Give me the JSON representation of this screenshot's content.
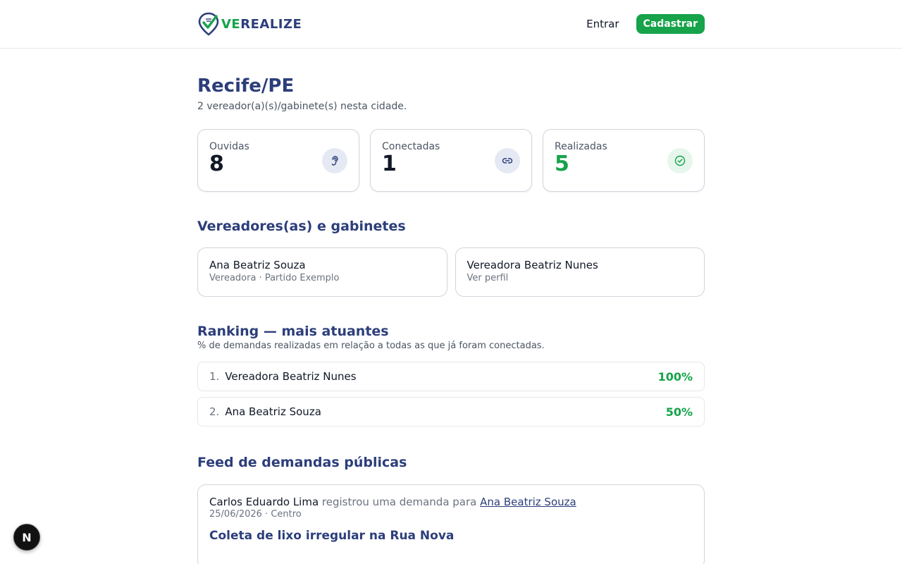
{
  "header": {
    "logo_prefix": "VE",
    "logo_rest": "REALIZE",
    "login_label": "Entrar",
    "signup_label": "Cadastrar"
  },
  "page": {
    "title": "Recife/PE",
    "subtitle": "2 vereador(a)(s)/gabinete(s) nesta cidade."
  },
  "stats": [
    {
      "label": "Ouvidas",
      "value": "8",
      "icon": "ear-icon"
    },
    {
      "label": "Conectadas",
      "value": "1",
      "icon": "link-icon"
    },
    {
      "label": "Realizadas",
      "value": "5",
      "icon": "check-circle-icon"
    }
  ],
  "council": {
    "title": "Vereadores(as) e gabinetes",
    "items": [
      {
        "name": "Ana Beatriz Souza",
        "meta": "Vereadora · Partido Exemplo"
      },
      {
        "name": "Vereadora Beatriz Nunes",
        "meta": "Ver perfil"
      }
    ]
  },
  "ranking": {
    "title": "Ranking — mais atuantes",
    "subtitle": "% de demandas realizadas em relação a todas as que já foram conectadas.",
    "items": [
      {
        "position": "1.",
        "name": "Vereadora Beatriz Nunes",
        "percent": "100%"
      },
      {
        "position": "2.",
        "name": "Ana Beatriz Souza",
        "percent": "50%"
      }
    ]
  },
  "feed": {
    "title": "Feed de demandas públicas",
    "items": [
      {
        "author": "Carlos Eduardo Lima",
        "action": " registrou uma demanda para ",
        "target": "Ana Beatriz Souza",
        "meta": "25/06/2026 · Centro",
        "title": "Coleta de lixo irregular na Rua Nova"
      }
    ]
  },
  "fab": {
    "label": "N"
  },
  "colors": {
    "brand_blue": "#2c3e7a",
    "brand_green": "#16a34a"
  }
}
